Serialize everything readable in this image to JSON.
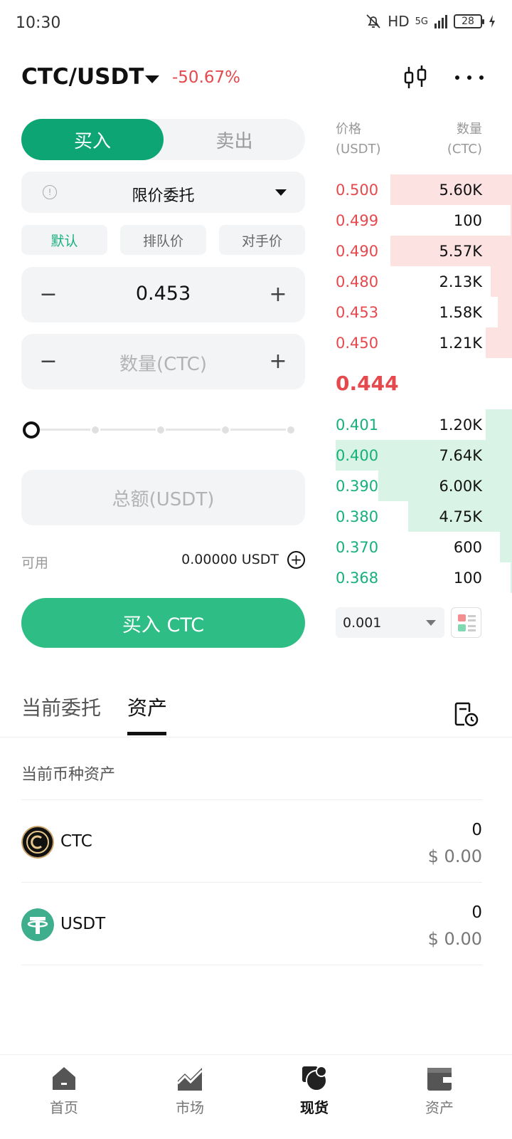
{
  "status_bar": {
    "time": "10:30",
    "network": "HD",
    "signal": "5G",
    "battery": "28"
  },
  "header": {
    "pair": "CTC/USDT",
    "change": "-50.67%"
  },
  "form": {
    "buy_tab": "买入",
    "sell_tab": "卖出",
    "order_type": "限价委托",
    "price_chips": [
      "默认",
      "排队价",
      "对手价"
    ],
    "price_value": "0.453",
    "amount_placeholder": "数量(CTC)",
    "total_placeholder": "总额(USDT)",
    "slider_percent": 0,
    "available_label": "可用",
    "available_value": "0.00000 USDT",
    "buy_button": "买入 CTC",
    "minus": "−",
    "plus": "+"
  },
  "orderbook": {
    "price_header_1": "价格",
    "price_header_2": "(USDT)",
    "qty_header_1": "数量",
    "qty_header_2": "(CTC)",
    "asks": [
      {
        "price": "0.500",
        "qty": "5.60K",
        "depth": 0.69
      },
      {
        "price": "0.499",
        "qty": "100",
        "depth": 0.01
      },
      {
        "price": "0.490",
        "qty": "5.57K",
        "depth": 0.69
      },
      {
        "price": "0.480",
        "qty": "2.13K",
        "depth": 0.12
      },
      {
        "price": "0.453",
        "qty": "1.58K",
        "depth": 0.08
      },
      {
        "price": "0.450",
        "qty": "1.21K",
        "depth": 0.15
      }
    ],
    "last_price": "0.444",
    "bids": [
      {
        "price": "0.401",
        "qty": "1.20K",
        "depth": 0.15
      },
      {
        "price": "0.400",
        "qty": "7.64K",
        "depth": 1.0
      },
      {
        "price": "0.390",
        "qty": "6.00K",
        "depth": 0.76
      },
      {
        "price": "0.380",
        "qty": "4.75K",
        "depth": 0.59
      },
      {
        "price": "0.370",
        "qty": "600",
        "depth": 0.07
      },
      {
        "price": "0.368",
        "qty": "100",
        "depth": 0.01
      }
    ],
    "precision": "0.001"
  },
  "section": {
    "tab_orders": "当前委托",
    "tab_assets": "资产",
    "assets_title": "当前币种资产",
    "assets": [
      {
        "symbol": "CTC",
        "amount": "0",
        "usd": "$ 0.00"
      },
      {
        "symbol": "USDT",
        "amount": "0",
        "usd": "$ 0.00"
      }
    ]
  },
  "nav": {
    "items": [
      {
        "label": "首页",
        "icon": "home-icon"
      },
      {
        "label": "市场",
        "icon": "market-chart-icon"
      },
      {
        "label": "现货",
        "icon": "spot-icon"
      },
      {
        "label": "资产",
        "icon": "wallet-icon"
      }
    ],
    "active_index": 2
  },
  "colors": {
    "buy_green": "#0ea575",
    "buy_button": "#2dbd85",
    "ask_red": "#e5494d",
    "bid_green": "#16b07c",
    "ask_bar": "#fde2e2",
    "bid_bar": "#d9f4e7"
  }
}
